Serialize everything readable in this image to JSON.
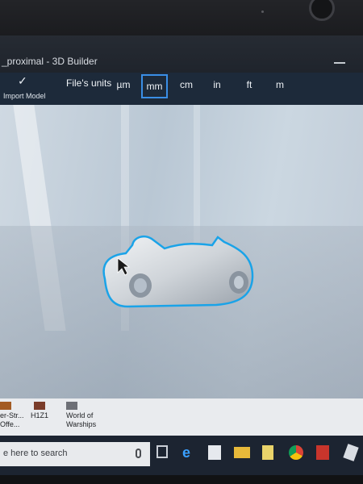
{
  "window": {
    "title": "_proximal - 3D Builder"
  },
  "ribbon": {
    "import_label": "Import Model",
    "units_label": "File's units",
    "units": [
      {
        "label": "µm",
        "selected": false
      },
      {
        "label": "mm",
        "selected": true
      },
      {
        "label": "cm",
        "selected": false
      },
      {
        "label": "in",
        "selected": false
      },
      {
        "label": "ft",
        "selected": false
      },
      {
        "label": "m",
        "selected": false
      }
    ]
  },
  "desktop": {
    "tiles": [
      {
        "line1": "er-Str...",
        "line2": "Offe..."
      },
      {
        "line1": "H1Z1",
        "line2": ""
      },
      {
        "line1": "World of",
        "line2": "Warships"
      }
    ]
  },
  "taskbar": {
    "search_placeholder": "e here to search",
    "icons": [
      "microphone-icon",
      "task-view-icon",
      "edge-icon",
      "store-icon",
      "file-explorer-icon",
      "notes-icon",
      "chrome-icon",
      "app-icon",
      "other-icon"
    ]
  },
  "colors": {
    "selection_outline": "#1aa3e8",
    "unit_highlight": "#3a8ee6",
    "ribbon_bg": "#1d2a3a",
    "taskbar_bg": "#1c2431"
  }
}
